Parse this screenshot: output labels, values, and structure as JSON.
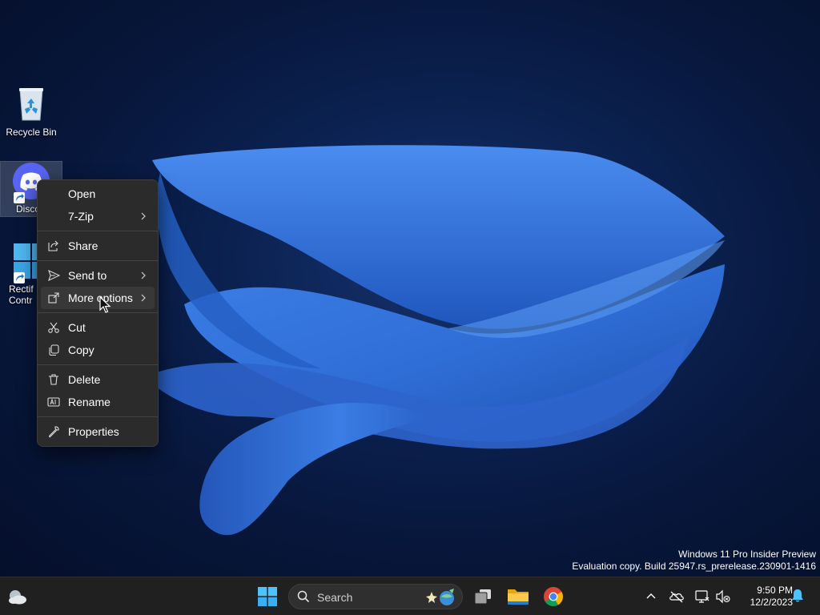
{
  "desktop": {
    "icons": [
      {
        "label": "Recycle Bin",
        "icon": "recycle-bin-icon"
      },
      {
        "label": "Disco",
        "icon": "discord-icon"
      },
      {
        "label": "Rectif Contr",
        "icon": "windows-logo-icon"
      }
    ]
  },
  "context_menu": {
    "items": [
      {
        "label": "Open",
        "icon": "",
        "submenu": false
      },
      {
        "label": "7-Zip",
        "icon": "",
        "submenu": true
      },
      {
        "label": "Share",
        "icon": "share-icon",
        "submenu": false
      },
      {
        "label": "Send to",
        "icon": "send-icon",
        "submenu": true
      },
      {
        "label": "More options",
        "icon": "more-options-icon",
        "submenu": true,
        "hovered": true
      },
      {
        "label": "Cut",
        "icon": "scissors-icon",
        "submenu": false
      },
      {
        "label": "Copy",
        "icon": "copy-icon",
        "submenu": false
      },
      {
        "label": "Delete",
        "icon": "trash-icon",
        "submenu": false
      },
      {
        "label": "Rename",
        "icon": "rename-icon",
        "submenu": false
      },
      {
        "label": "Properties",
        "icon": "wrench-icon",
        "submenu": false
      }
    ]
  },
  "watermark": {
    "line1": "Windows 11 Pro Insider Preview",
    "line2": "Evaluation copy. Build 25947.rs_prerelease.230901-1416"
  },
  "taskbar": {
    "search_label": "Search",
    "apps": [
      "start-icon",
      "task-view-icon",
      "file-explorer-icon",
      "chrome-icon"
    ],
    "tray": [
      "chevron-up-icon",
      "onedrive-icon",
      "network-icon",
      "volume-muted-icon",
      "bell-icon"
    ],
    "time": "9:50 PM",
    "date": "12/2/2023"
  },
  "colors": {
    "menu_bg": "#2b2b2b",
    "taskbar_bg": "#202020",
    "accent": "#4cc2ff",
    "wallpaper_blue": "#2f6fd6"
  }
}
